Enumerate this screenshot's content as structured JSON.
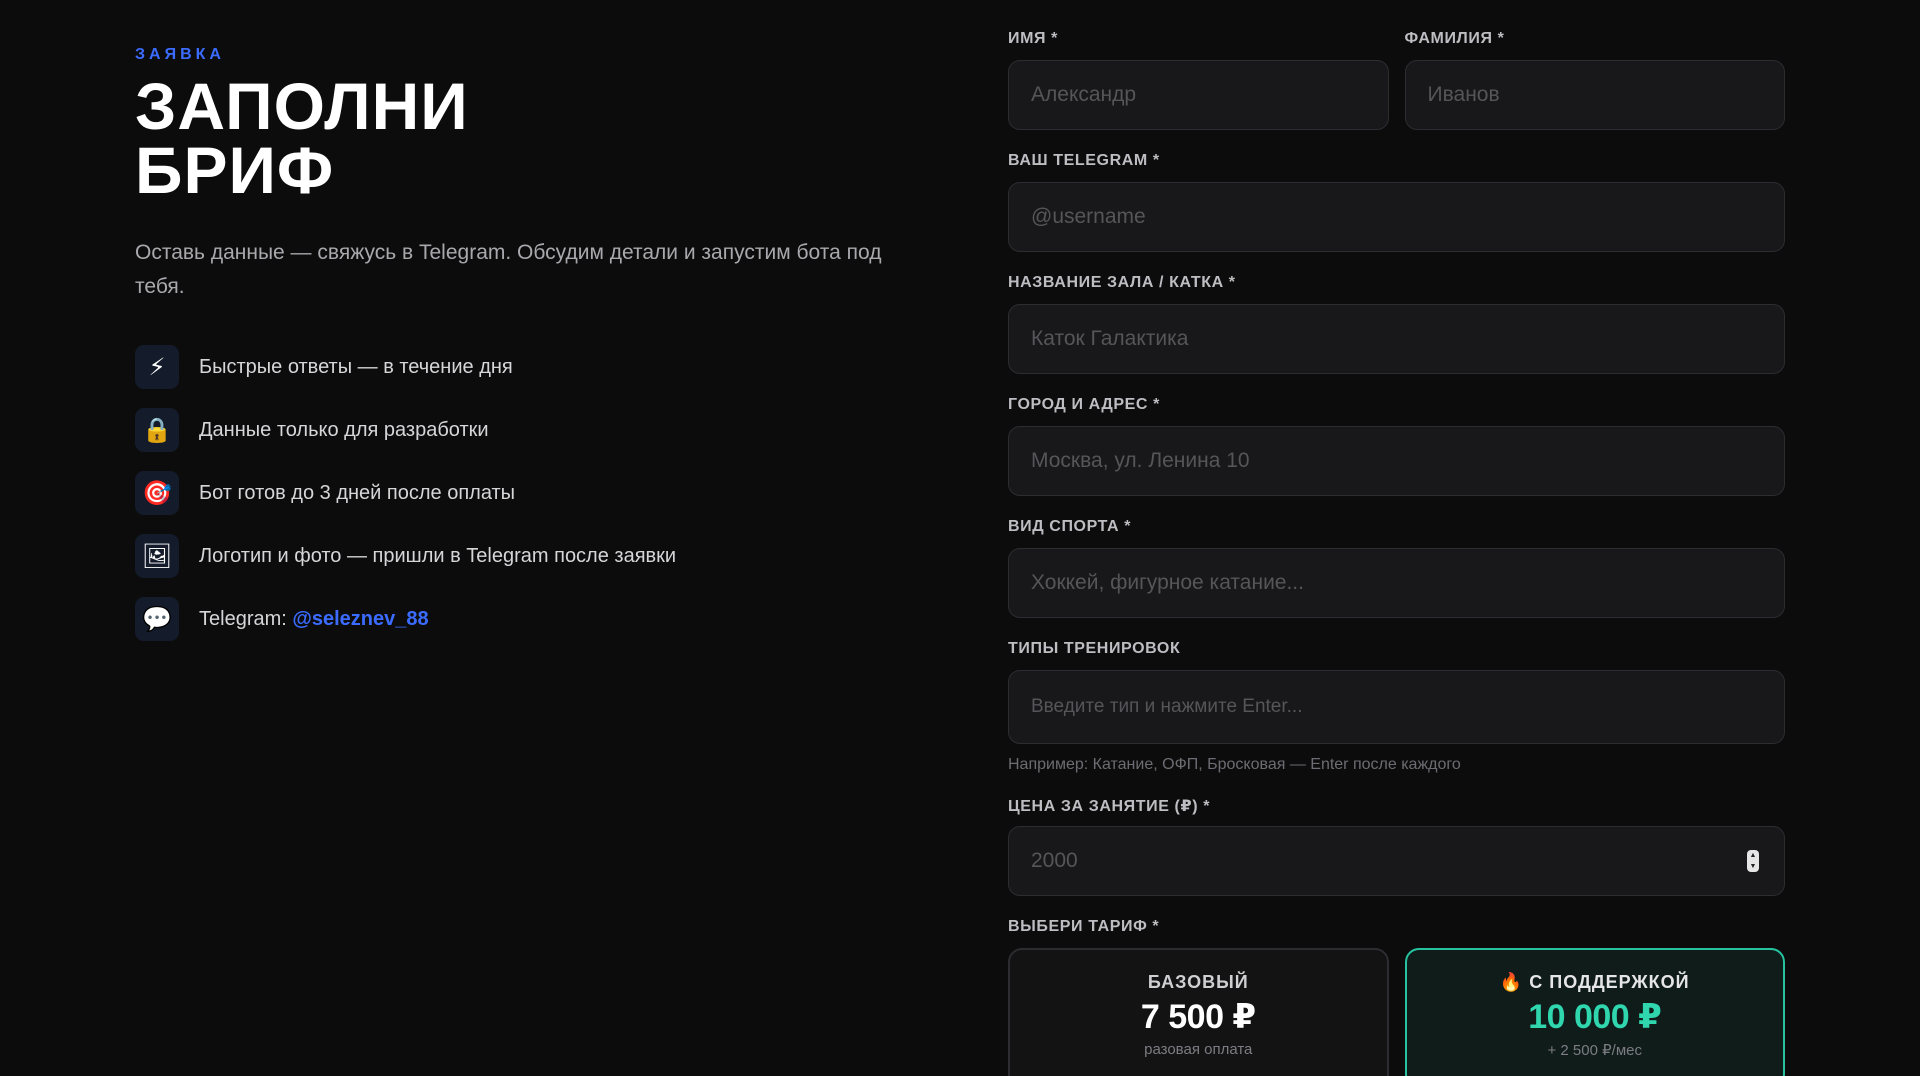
{
  "intro": {
    "eyebrow": "ЗАЯВКА",
    "title_line1": "ЗАПОЛНИ",
    "title_line2": "БРИФ",
    "subtitle": "Оставь данные — свяжусь в Telegram. Обсудим детали и запустим бота под тебя."
  },
  "features": [
    {
      "icon": "lightning-icon",
      "glyph": "⚡",
      "text": "Быстрые ответы — в течение дня"
    },
    {
      "icon": "lock-icon",
      "glyph": "🔒",
      "text": "Данные только для разработки"
    },
    {
      "icon": "target-icon",
      "glyph": "🎯",
      "text": "Бот готов до 3 дней после оплаты"
    },
    {
      "icon": "picture-icon",
      "glyph": "🖼",
      "text": "Логотип и фото — пришли в Telegram после заявки"
    },
    {
      "icon": "speech-bubble-icon",
      "glyph": "💬",
      "text": "Telegram: ",
      "link": "@seleznev_88"
    }
  ],
  "form": {
    "first_name": {
      "label": "ИМЯ *",
      "placeholder": "Александр",
      "value": ""
    },
    "last_name": {
      "label": "ФАМИЛИЯ *",
      "placeholder": "Иванов",
      "value": ""
    },
    "telegram": {
      "label": "ВАШ TELEGRAM *",
      "placeholder": "@username",
      "value": ""
    },
    "venue": {
      "label": "НАЗВАНИЕ ЗАЛА / КАТКА *",
      "placeholder": "Каток Галактика",
      "value": ""
    },
    "address": {
      "label": "ГОРОД И АДРЕС *",
      "placeholder": "Москва, ул. Ленина 10",
      "value": ""
    },
    "sport": {
      "label": "ВИД СПОРТА *",
      "placeholder": "Хоккей, фигурное катание...",
      "value": ""
    },
    "training_types": {
      "label": "ТИПЫ ТРЕНИРОВОК",
      "placeholder": "Введите тип и нажмите Enter...",
      "hint": "Например: Катание, ОФП, Бросковая — Enter после каждого"
    },
    "price": {
      "label": "ЦЕНА ЗА ЗАНЯТИЕ (₽) *",
      "placeholder": "2000",
      "value": ""
    },
    "tariff_label": "ВЫБЕРИ ТАРИФ *",
    "tariffs": [
      {
        "name": "БАЗОВЫЙ",
        "price": "7 500 ₽",
        "note": "разовая оплата",
        "note2": "",
        "active": false
      },
      {
        "name": "🔥 С ПОДДЕРЖКОЙ",
        "price": "10 000 ₽",
        "note": "+ 2 500 ₽/мес",
        "note2": "",
        "active": true
      }
    ]
  },
  "colors": {
    "background": "#0c0c0d",
    "accent_blue": "#3b6cff",
    "accent_teal": "#27c3a0"
  }
}
